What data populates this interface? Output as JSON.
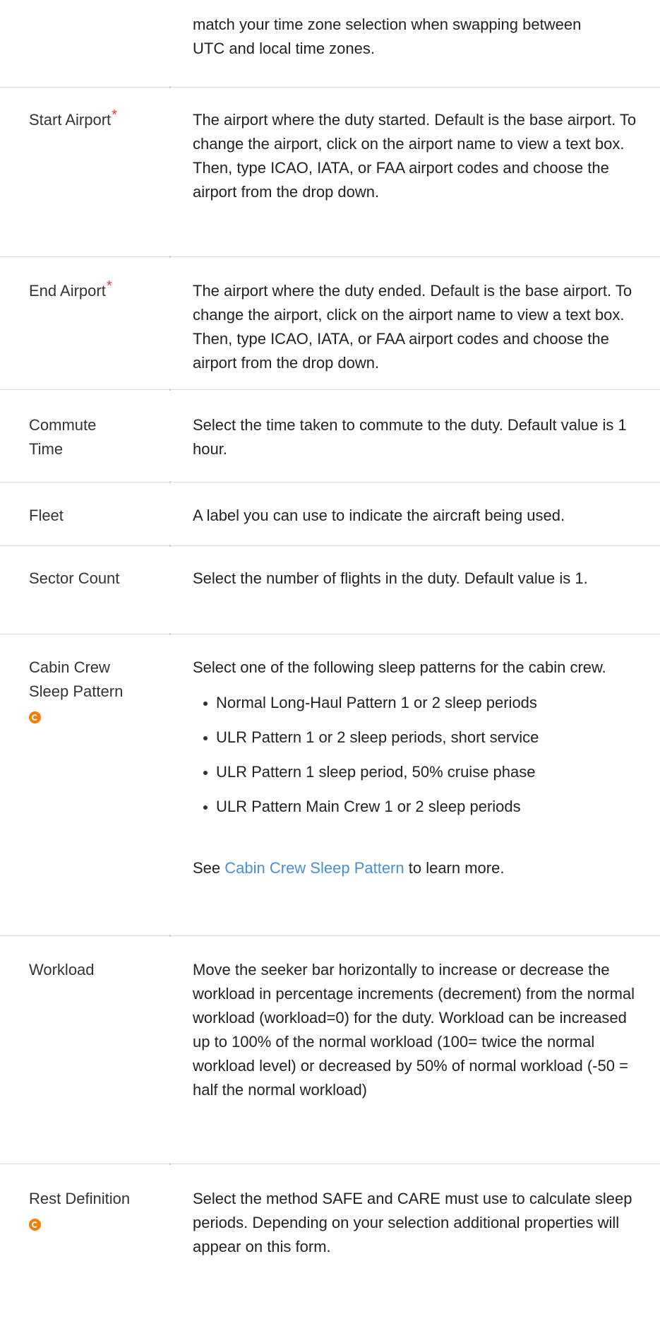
{
  "rows": [
    {
      "label": "",
      "desc": "match your time zone selection when swapping between UTC and local time zones."
    },
    {
      "label": "Start Airport",
      "required": "*",
      "desc": "The airport where the duty started. Default is the base airport. To change the airport, click on the airport name to view a text box. Then, type ICAO, IATA, or FAA airport codes and choose the airport from the drop down."
    },
    {
      "label": "End Airport",
      "required": "*",
      "desc": "The airport where the duty ended. Default is the base airport. To change the airport, click on the airport name to view a text box. Then, type ICAO, IATA, or FAA airport codes and choose the airport from the drop down."
    },
    {
      "label": "Commute Time",
      "desc": "Select the time taken to commute to the duty. Default value is 1 hour."
    },
    {
      "label": "Fleet",
      "desc": "A label you can use to indicate the aircraft being used."
    },
    {
      "label": "Sector Count",
      "desc": "Select the number of flights in the duty. Default value is 1."
    },
    {
      "label": "Cabin Crew Sleep Pattern",
      "icon": "care-icon",
      "desc": "Select one of the following sleep patterns for the cabin crew.",
      "items": [
        "Normal Long-Haul Pattern 1 or 2 sleep periods",
        "ULR Pattern 1 or 2 sleep periods, short service",
        "ULR Pattern 1 sleep period, 50% cruise phase",
        "ULR Pattern Main Crew 1 or 2 sleep periods"
      ],
      "see_prefix": "See ",
      "see_link": "Cabin Crew Sleep Pattern",
      "see_suffix": " to learn more."
    },
    {
      "label": "Workload",
      "desc": "Move the seeker bar horizontally to increase or decrease the workload in percentage increments (decrement) from the normal workload (workload=0) for the duty. Workload can be increased up to 100% of the normal workload (100= twice the normal workload level) or decreased by 50% of normal workload (-50 = half the normal workload)"
    },
    {
      "label": "Rest Definition",
      "icon": "care-icon",
      "desc": "Select the method SAFE and CARE must use to calculate sleep periods. Depending on your selection additional properties will appear on this form."
    }
  ],
  "colors": {
    "required": "#e53935",
    "care_icon": "#f57c00",
    "link": "#4a8fd6",
    "divider": "#dcdcdc"
  }
}
